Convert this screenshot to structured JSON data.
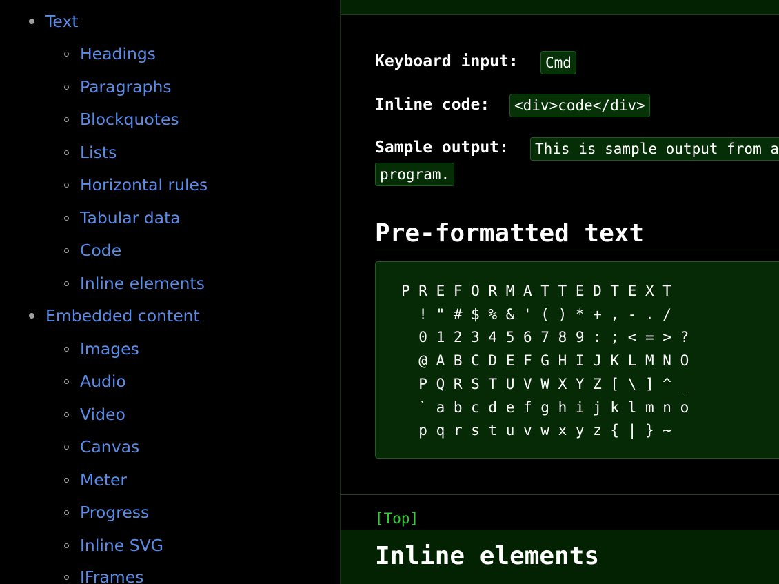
{
  "toc": {
    "sections": [
      {
        "label": "Text",
        "children": [
          "Headings",
          "Paragraphs",
          "Blockquotes",
          "Lists",
          "Horizontal rules",
          "Tabular data",
          "Code",
          "Inline elements"
        ]
      },
      {
        "label": "Embedded content",
        "children": [
          "Images",
          "Audio",
          "Video",
          "Canvas",
          "Meter",
          "Progress",
          "Inline SVG",
          "IFrames"
        ]
      }
    ]
  },
  "inline": {
    "keyboard_label": "Keyboard input:",
    "keyboard_value": "Cmd",
    "code_label": "Inline code:",
    "code_value": "<div>code</div>",
    "sample_label": "Sample output:",
    "sample_value_line1": "This is sample output from a computer",
    "sample_value_line2": "program."
  },
  "preformatted": {
    "title": "Pre-formatted text",
    "content": "P R E F O R M A T T E D T E X T\n  ! \" # $ % & ' ( ) * + , - . /\n  0 1 2 3 4 5 6 7 8 9 : ; < = > ?\n  @ A B C D E F G H I J K L M N O\n  P Q R S T U V W X Y Z [ \\ ] ^ _\n  ` a b c d e f g h i j k l m n o\n  p q r s t u v w x y z { | } ~"
  },
  "footer": {
    "top_link": "[Top]",
    "next_section_title": "Inline elements"
  },
  "colors": {
    "link": "#5b8de8",
    "accent_green": "#2fd02f",
    "code_background": "#073207",
    "band_background": "#022202"
  }
}
